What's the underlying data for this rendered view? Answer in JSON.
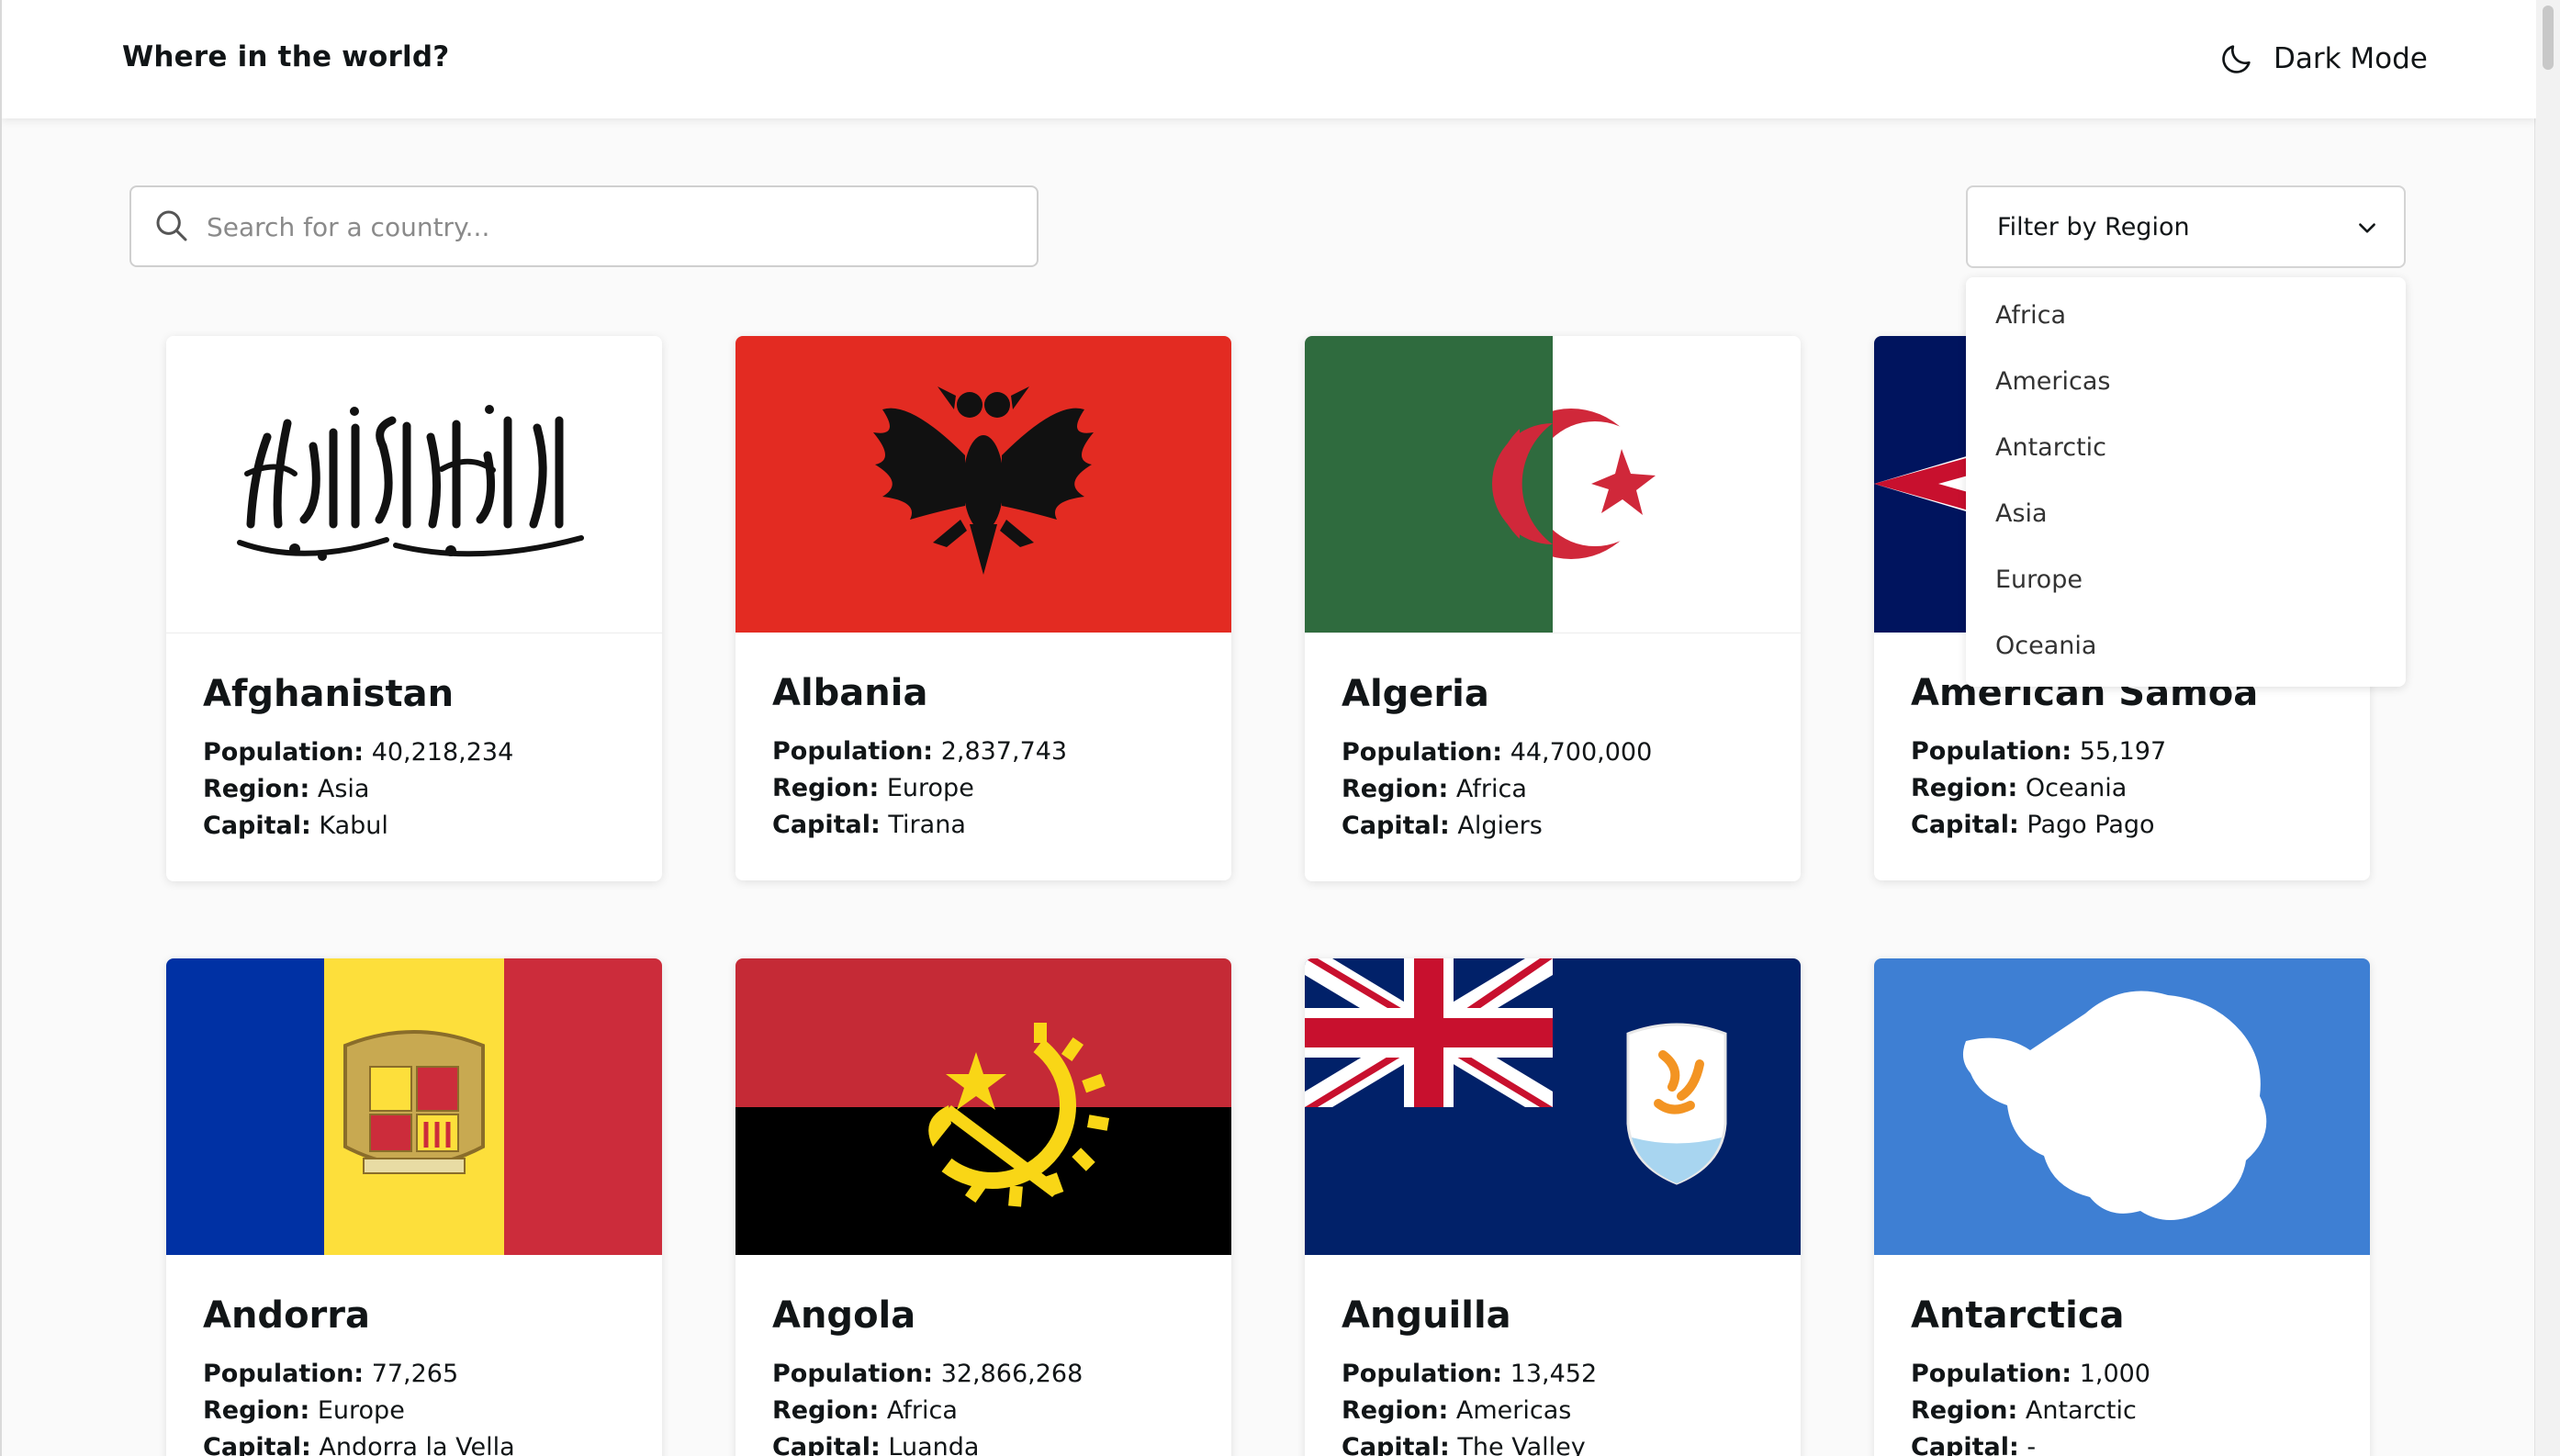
{
  "header": {
    "title": "Where in the world?",
    "mode_toggle_label": "Dark Mode"
  },
  "search": {
    "placeholder": "Search for a country..."
  },
  "filter": {
    "label": "Filter by Region",
    "options": [
      "Africa",
      "Americas",
      "Antarctic",
      "Asia",
      "Europe",
      "Oceania"
    ]
  },
  "labels": {
    "population": "Population:",
    "region": "Region:",
    "capital": "Capital:"
  },
  "countries": [
    {
      "name": "Afghanistan",
      "population": "40,218,234",
      "region": "Asia",
      "capital": "Kabul"
    },
    {
      "name": "Albania",
      "population": "2,837,743",
      "region": "Europe",
      "capital": "Tirana"
    },
    {
      "name": "Algeria",
      "population": "44,700,000",
      "region": "Africa",
      "capital": "Algiers"
    },
    {
      "name": "American Samoa",
      "population": "55,197",
      "region": "Oceania",
      "capital": "Pago Pago"
    },
    {
      "name": "Andorra",
      "population": "77,265",
      "region": "Europe",
      "capital": "Andorra la Vella"
    },
    {
      "name": "Angola",
      "population": "32,866,268",
      "region": "Africa",
      "capital": "Luanda"
    },
    {
      "name": "Anguilla",
      "population": "13,452",
      "region": "Americas",
      "capital": "The Valley"
    },
    {
      "name": "Antarctica",
      "population": "1,000",
      "region": "Antarctic",
      "capital": "-"
    }
  ],
  "colors": {
    "albania_red": "#e32b22",
    "algeria_green": "#2f6b3e",
    "algeria_red": "#d0283a",
    "samoa_blue": "#00145e",
    "andorra_blue": "#0031a4",
    "andorra_yellow": "#fddf3b",
    "andorra_red": "#cc2c3b",
    "angola_red": "#c52a36",
    "anguilla_blue": "#012169",
    "antarctica_blue": "#3e7fd3"
  }
}
